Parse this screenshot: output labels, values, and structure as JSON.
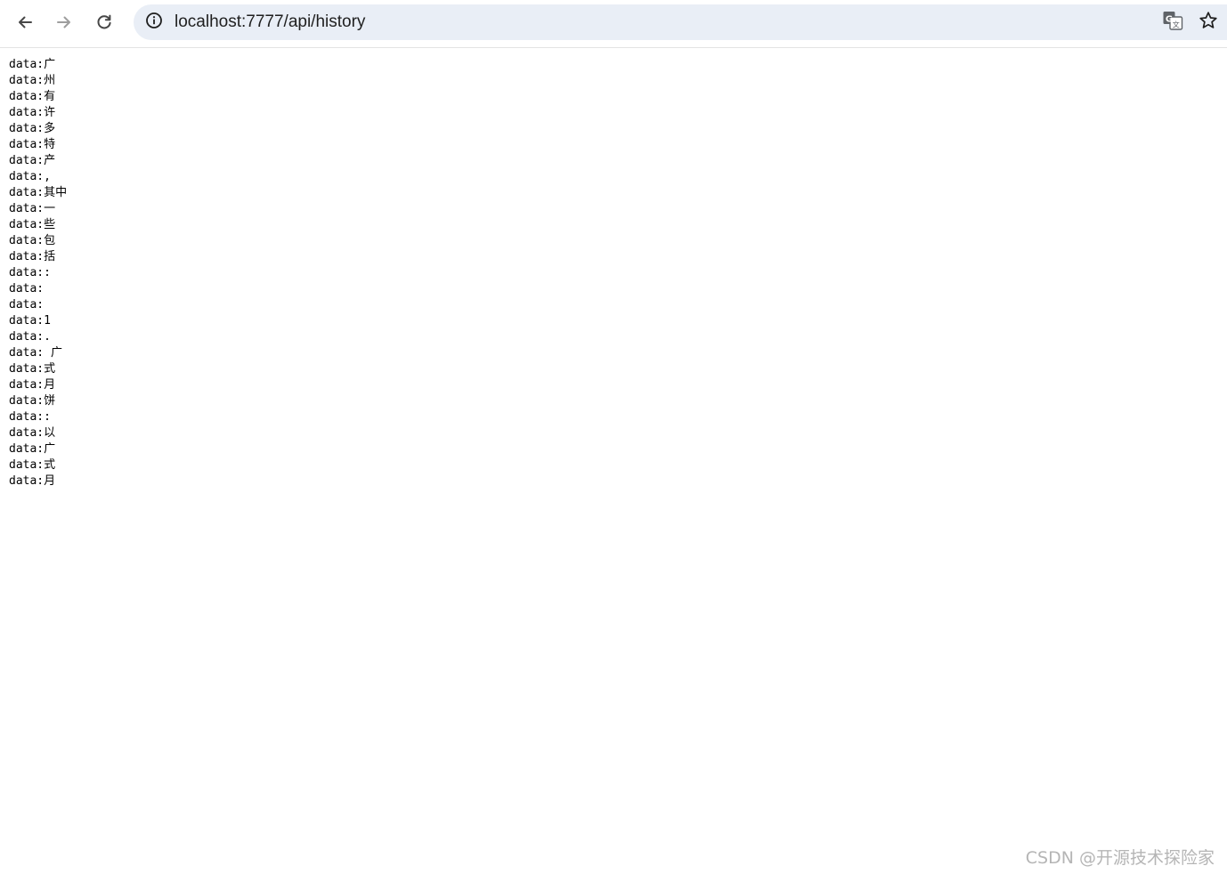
{
  "browser": {
    "url": "localhost:7777/api/history",
    "icons": {
      "back": "arrow-left-icon",
      "forward": "arrow-right-icon",
      "reload": "reload-icon",
      "site_info": "info-circle-icon",
      "translate": "translate-icon",
      "bookmark": "star-outline-icon"
    },
    "colors": {
      "omnibox_background": "#e9eef6",
      "toolbar_background": "#ffffff",
      "icon_enabled": "#474747",
      "icon_disabled": "#9e9e9e"
    }
  },
  "page": {
    "lines": [
      "data:广",
      "data:州",
      "data:有",
      "data:许",
      "data:多",
      "data:特",
      "data:产",
      "data:,",
      "data:其中",
      "data:一",
      "data:些",
      "data:包",
      "data:括",
      "data::\ndata:\ndata:",
      "data:1",
      "data:.",
      "data: 广",
      "data:式",
      "data:月",
      "data:饼",
      "data::",
      "data:以",
      "data:广",
      "data:式",
      "data:月"
    ]
  },
  "watermark": {
    "text": "CSDN @开源技术探险家"
  }
}
